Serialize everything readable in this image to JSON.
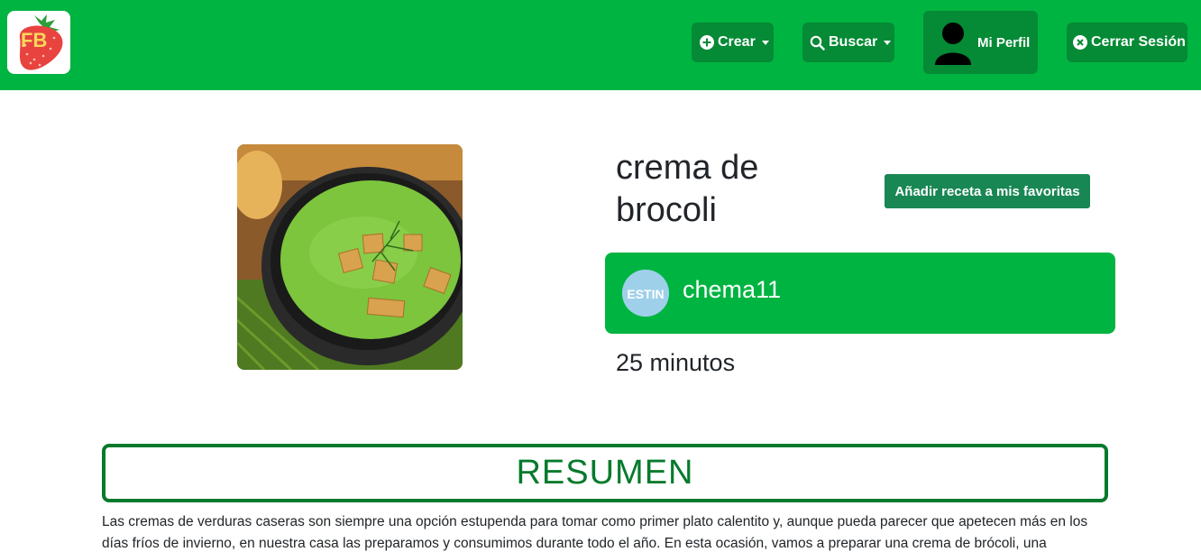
{
  "navbar": {
    "logo_text": "FB",
    "crear_label": "Crear",
    "buscar_label": "Buscar",
    "perfil_label": "Mi Perfil",
    "cerrar_label": "Cerrar Sesión",
    "background_color": "#00b441",
    "button_color": "#058a35"
  },
  "recipe": {
    "title": "crema de brocoli",
    "favorite_button_label": "Añadir receta a mis favoritas",
    "author": {
      "username": "chema11",
      "avatar_text": "ESTIN"
    },
    "duration": "25 minutos",
    "image_alt": "crema de brocoli"
  },
  "summary": {
    "heading": "RESUMEN",
    "text": "Las cremas de verduras caseras son siempre una opción estupenda para tomar como primer plato calentito y, aunque pueda parecer que apetecen más en los días fríos de invierno, en nuestra casa las preparamos y consumimos durante todo el año. En esta ocasión, vamos a preparar una crema de brócoli, una"
  },
  "icons": {
    "crear": "plus-circle-icon",
    "buscar": "search-icon",
    "perfil": "user-silhouette-icon",
    "cerrar": "x-circle-icon",
    "dropdown": "caret-down-icon"
  }
}
